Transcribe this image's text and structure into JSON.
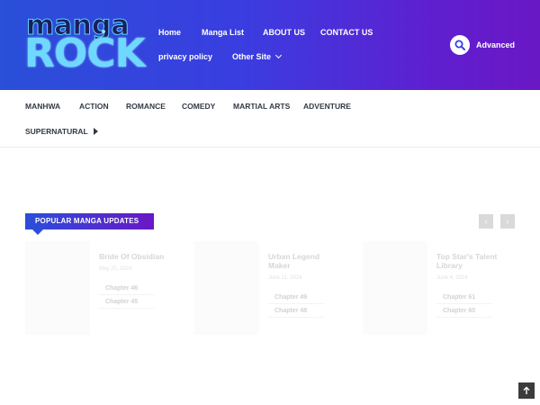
{
  "logo": {
    "top": "manga",
    "bottom": "ROCK"
  },
  "nav": {
    "home": "Home",
    "manga_list": "Manga List",
    "about": "ABOUT US",
    "contact": "CONTACT US",
    "privacy": "privacy policy",
    "other_site": "Other Site"
  },
  "search": {
    "advanced_label": "Advanced"
  },
  "genres": {
    "manhwa": "MANHWA",
    "action": "ACTION",
    "romance": "ROMANCE",
    "comedy": "COMEDY",
    "martial_arts": "MARTIAL ARTS",
    "adventure": "ADVENTURE",
    "supernatural": "SUPERNATURAL"
  },
  "section": {
    "title": "POPULAR MANGA UPDATES",
    "prev": "‹",
    "next": "›"
  },
  "cards": [
    {
      "title": "Bride Of Obsidian",
      "date": "May 25, 2024",
      "chapters": [
        "Chapter 46",
        "Chapter 45"
      ]
    },
    {
      "title": "Urban Legend Maker",
      "date": "June 11, 2024",
      "chapters": [
        "Chapter 49",
        "Chapter 48"
      ]
    },
    {
      "title": "Top Star's Talent Library",
      "date": "June 4, 2024",
      "chapters": [
        "Chapter 61",
        "Chapter 60"
      ]
    }
  ],
  "icons": {
    "search": "search-icon",
    "scroll_top": "arrow-up-icon"
  },
  "colors": {
    "header_start": "#2a4fd9",
    "header_end": "#6a17c5",
    "logo": "#6fd8ff"
  }
}
